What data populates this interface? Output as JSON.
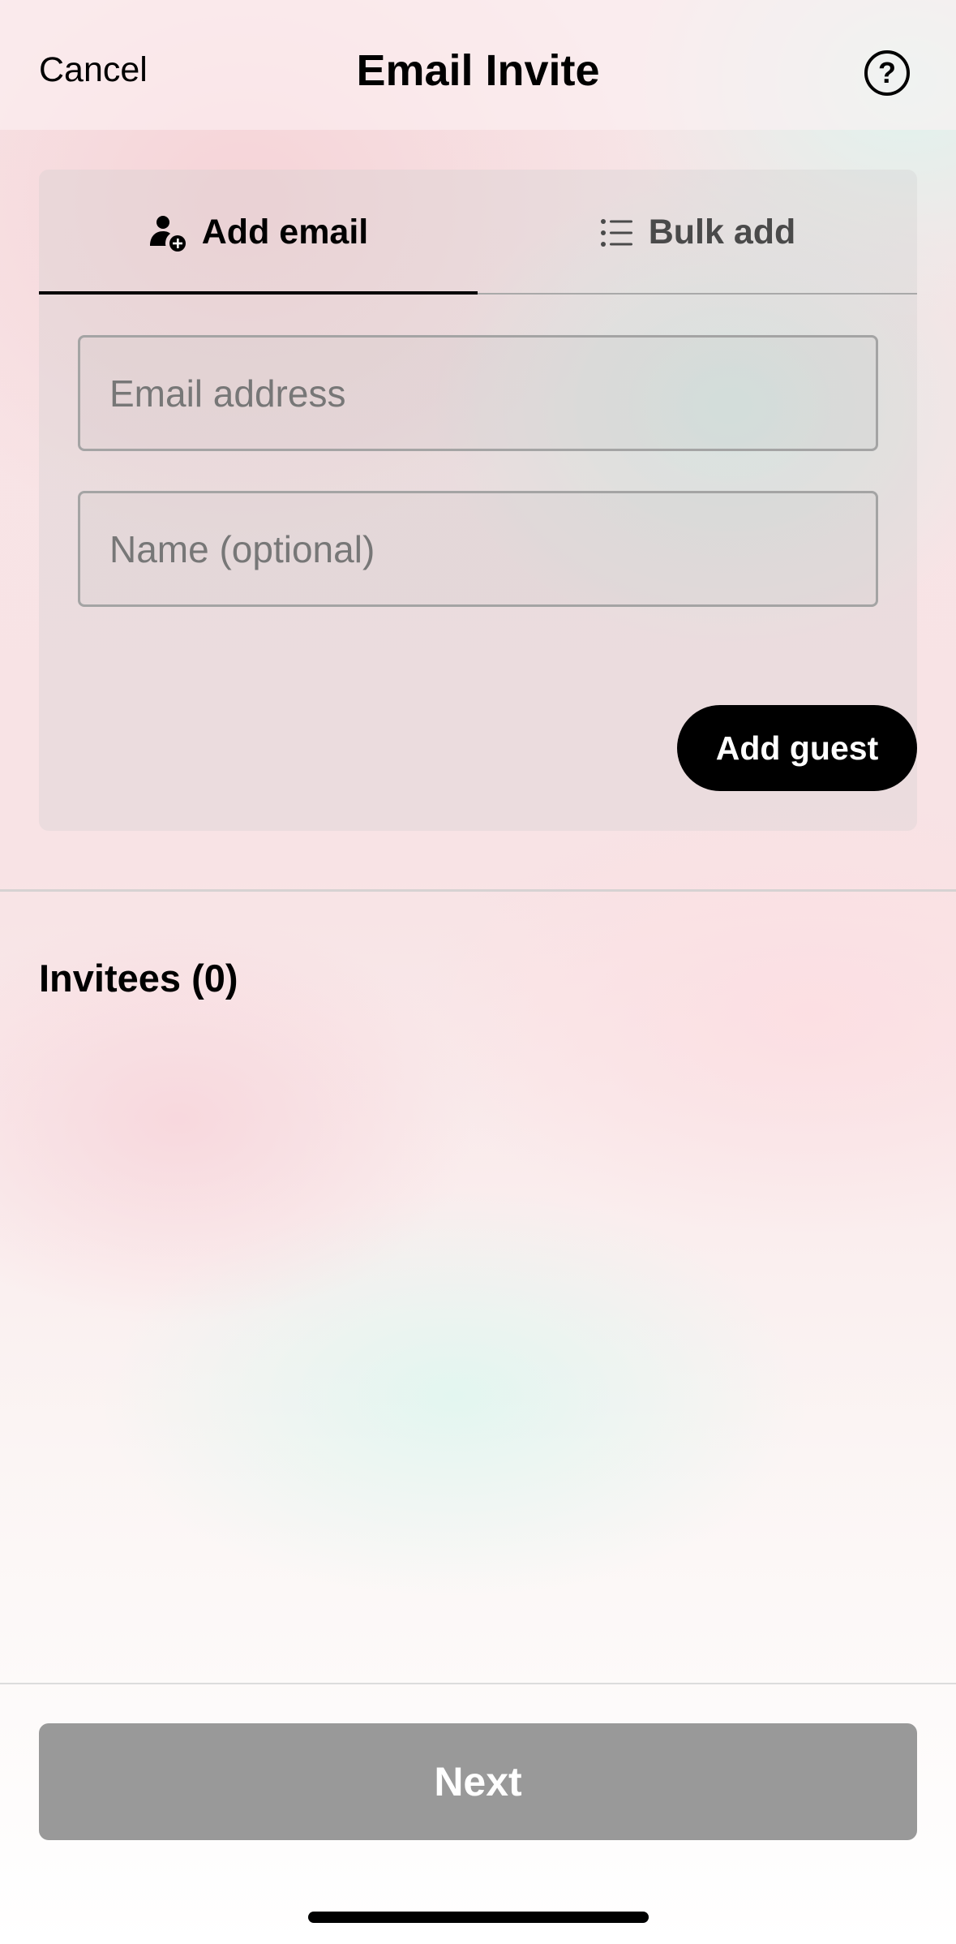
{
  "header": {
    "cancel_label": "Cancel",
    "title": "Email Invite",
    "help_label": "?"
  },
  "tabs": [
    {
      "label": "Add email",
      "icon": "person-add-icon",
      "active": true
    },
    {
      "label": "Bulk add",
      "icon": "list-icon",
      "active": false
    }
  ],
  "form": {
    "email_placeholder": "Email address",
    "email_value": "",
    "name_placeholder": "Name (optional)",
    "name_value": "",
    "add_guest_label": "Add guest"
  },
  "invitees": {
    "heading": "Invitees (0)",
    "items": []
  },
  "footer": {
    "next_label": "Next",
    "next_enabled": false
  },
  "colors": {
    "primary_button": "#000000",
    "disabled_button": "#999999",
    "text": "#000000",
    "placeholder": "#777777"
  }
}
